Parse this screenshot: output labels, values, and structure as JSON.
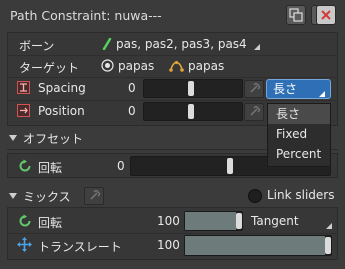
{
  "window": {
    "title": "Path Constraint: nuwa---"
  },
  "toolbar": {
    "copy_icon": "copy-icon",
    "reset_label": "R",
    "close_label": "✕"
  },
  "bones_row": {
    "label": "ボーン",
    "value": "pas, pas2, pas3, pas4"
  },
  "target_row": {
    "label": "ターゲット",
    "target_name": "papas",
    "path_name": "papas"
  },
  "spacing_row": {
    "label": "Spacing",
    "value": "0",
    "mode": "長さ",
    "level": 0.45
  },
  "position_row": {
    "label": "Position",
    "value": "0",
    "level": 0.45
  },
  "spacing_menu": {
    "options": [
      "長さ",
      "Fixed",
      "Percent"
    ],
    "selected": "長さ"
  },
  "offset_section": {
    "title": "オフセット",
    "rotate_label": "回転",
    "rotate_value": "0",
    "rotate_level": 0.5
  },
  "mix_section": {
    "title": "ミックス",
    "link_sliders_label": "Link sliders",
    "rotate_label": "回転",
    "rotate_value": "100",
    "rotate_mode": "Tangent",
    "translate_label": "トランスレート",
    "translate_value": "100",
    "rotate_level": 1.0,
    "translate_level": 1.0
  },
  "colors": {
    "background": "#3b3b3b",
    "accent": "#2f6fb5",
    "bone_icon": "#56d15a",
    "close": "#d23a3a"
  }
}
